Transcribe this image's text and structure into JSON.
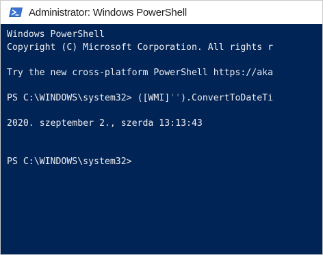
{
  "window": {
    "title": "Administrator: Windows PowerShell",
    "icon": "powershell-icon",
    "background_color": "#012456",
    "text_color": "#eeedf0"
  },
  "console": {
    "header_line1": "Windows PowerShell",
    "header_line2": "Copyright (C) Microsoft Corporation. All rights r",
    "tip_line": "Try the new cross-platform PowerShell https://aka",
    "prompt1": "PS C:\\WINDOWS\\system32> ",
    "command_part1": "([WMI]",
    "command_quotes": "''",
    "command_part2": ").ConvertToDateTi",
    "output_line": "2020. szeptember 2., szerda 13:13:43",
    "prompt2": "PS C:\\WINDOWS\\system32>"
  }
}
